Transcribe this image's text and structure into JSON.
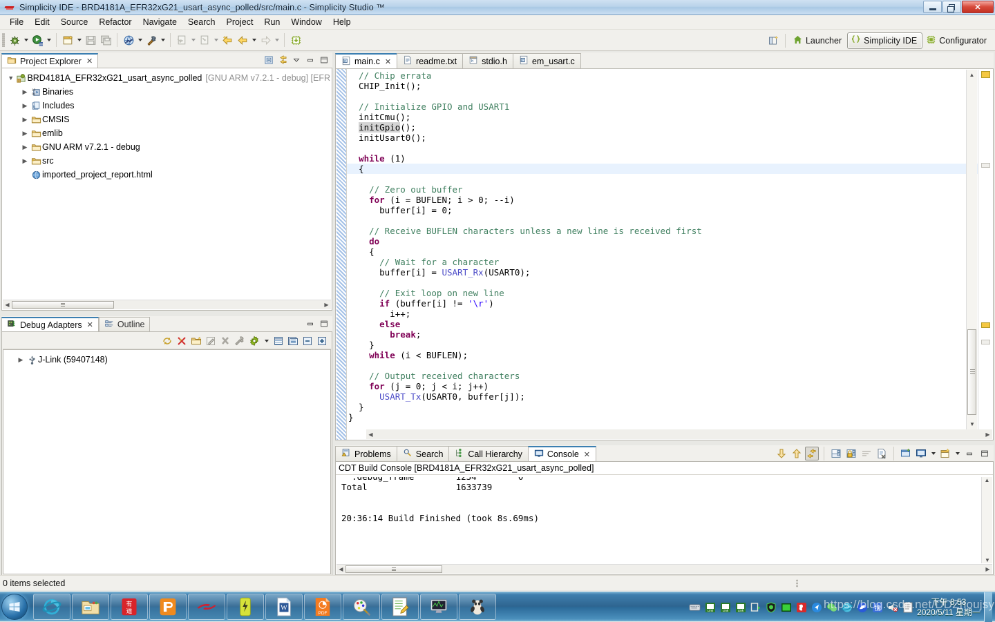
{
  "window": {
    "title": "Simplicity IDE - BRD4181A_EFR32xG21_usart_async_polled/src/main.c - Simplicity Studio ™",
    "app_icon": "simplicity-studio-icon",
    "minimize_label": "Minimize",
    "restore_label": "Restore",
    "close_label": "Close"
  },
  "menubar": {
    "items": [
      "File",
      "Edit",
      "Source",
      "Refactor",
      "Navigate",
      "Search",
      "Project",
      "Run",
      "Window",
      "Help"
    ]
  },
  "toolbar": {
    "buttons": [
      {
        "name": "debug-icon",
        "glyph": "bug"
      },
      {
        "name": "run-icon",
        "glyph": "run"
      },
      {
        "name": "new-icon",
        "glyph": "new"
      },
      {
        "name": "save-icon",
        "glyph": "save"
      },
      {
        "name": "save-all-icon",
        "glyph": "saveall"
      },
      {
        "name": "build-all-icon",
        "glyph": "globe"
      },
      {
        "name": "build-icon",
        "glyph": "hammer"
      },
      {
        "name": "next-annotation-icon",
        "glyph": "nextanno"
      },
      {
        "name": "previous-annotation-icon",
        "glyph": "prevanno"
      },
      {
        "name": "last-edit-location-icon",
        "glyph": "lastedit"
      },
      {
        "name": "back-icon",
        "glyph": "back"
      },
      {
        "name": "forward-icon",
        "glyph": "forward"
      },
      {
        "name": "flash-programmer-icon",
        "glyph": "chip"
      }
    ]
  },
  "perspectives": {
    "open_perspective_label": "Open Perspective",
    "items": [
      {
        "label": "Launcher",
        "icon": "home-icon",
        "active": false
      },
      {
        "label": "Simplicity IDE",
        "icon": "braces-icon",
        "active": true
      },
      {
        "label": "Configurator",
        "icon": "chip-icon",
        "active": false
      }
    ]
  },
  "project_explorer": {
    "tabs": [
      {
        "label": "Project Explorer",
        "active": true,
        "icon": "project-explorer-icon",
        "closable": true
      }
    ],
    "toolbar": [
      {
        "name": "collapse-all-icon"
      },
      {
        "name": "link-with-editor-icon"
      },
      {
        "name": "view-menu-icon"
      },
      {
        "name": "minimize-view-icon"
      },
      {
        "name": "maximize-view-icon"
      }
    ],
    "tree": [
      {
        "indent": 0,
        "twisty": "open",
        "icon": "project-icon",
        "label": "BRD4181A_EFR32xG21_usart_async_polled",
        "suffix": "[GNU ARM v7.2.1 - debug] [EFR"
      },
      {
        "indent": 1,
        "twisty": "closed",
        "icon": "binaries-icon",
        "label": "Binaries",
        "suffix": ""
      },
      {
        "indent": 1,
        "twisty": "closed",
        "icon": "includes-icon",
        "label": "Includes",
        "suffix": ""
      },
      {
        "indent": 1,
        "twisty": "closed",
        "icon": "folder-icon",
        "label": "CMSIS",
        "suffix": ""
      },
      {
        "indent": 1,
        "twisty": "closed",
        "icon": "folder-icon",
        "label": "emlib",
        "suffix": ""
      },
      {
        "indent": 1,
        "twisty": "closed",
        "icon": "folder-icon",
        "label": "GNU ARM v7.2.1 - debug",
        "suffix": ""
      },
      {
        "indent": 1,
        "twisty": "closed",
        "icon": "source-folder-icon",
        "label": "src",
        "suffix": ""
      },
      {
        "indent": 1,
        "twisty": "none",
        "icon": "html-file-icon",
        "label": "imported_project_report.html",
        "suffix": ""
      }
    ]
  },
  "debug_adapters": {
    "tabs": [
      {
        "label": "Debug Adapters",
        "active": true,
        "icon": "debug-adapters-icon",
        "closable": true
      },
      {
        "label": "Outline",
        "active": false,
        "icon": "outline-icon",
        "closable": false
      }
    ],
    "toolbar": [
      {
        "name": "refresh-icon"
      },
      {
        "name": "disconnect-icon"
      },
      {
        "name": "new-folder-icon"
      },
      {
        "name": "rename-icon"
      },
      {
        "name": "delete-icon"
      },
      {
        "name": "device-tools-icon"
      },
      {
        "name": "preferences-gear-icon"
      },
      {
        "name": "dropdown-arrow-icon"
      },
      {
        "name": "list-view-icon"
      },
      {
        "name": "details-view-icon"
      },
      {
        "name": "collapse-all-icon"
      },
      {
        "name": "expand-all-icon"
      }
    ],
    "tree": [
      {
        "indent": 0,
        "twisty": "closed",
        "icon": "usb-icon",
        "label": "J-Link (59407148)"
      }
    ]
  },
  "editor": {
    "tabs": [
      {
        "label": "main.c",
        "icon": "c-file-icon",
        "active": true,
        "closable": true
      },
      {
        "label": "readme.txt",
        "icon": "text-file-icon",
        "active": false,
        "closable": false
      },
      {
        "label": "stdio.h",
        "icon": "h-file-icon",
        "active": false,
        "closable": false
      },
      {
        "label": "em_usart.c",
        "icon": "c-file-icon",
        "active": false,
        "closable": false
      }
    ],
    "code_lines": [
      "  // Chip errata",
      "  CHIP_Init();",
      "",
      "  // Initialize GPIO and USART1",
      "  initCmu();",
      "  initGpio();",
      "  initUsart0();",
      "",
      "  while (1)",
      "  {",
      "",
      "    // Zero out buffer",
      "    for (i = BUFLEN; i > 0; --i)",
      "      buffer[i] = 0;",
      "",
      "    // Receive BUFLEN characters unless a new line is received first",
      "    do",
      "    {",
      "      // Wait for a character",
      "      buffer[i] = USART_Rx(USART0);",
      "",
      "      // Exit loop on new line",
      "      if (buffer[i] != '\\r')",
      "        i++;",
      "      else",
      "        break;",
      "    }",
      "    while (i < BUFLEN);",
      "",
      "    // Output received characters",
      "    for (j = 0; j < i; j++)",
      "      USART_Tx(USART0, buffer[j]);",
      "  }",
      "}"
    ],
    "highlighted_token": "initGpio",
    "highlighted_line_index": 9
  },
  "console": {
    "tabs": [
      {
        "label": "Problems",
        "icon": "problems-icon",
        "active": false,
        "closable": false
      },
      {
        "label": "Search",
        "icon": "search-icon",
        "active": false,
        "closable": false
      },
      {
        "label": "Call Hierarchy",
        "icon": "call-hierarchy-icon",
        "active": false,
        "closable": false
      },
      {
        "label": "Console",
        "icon": "console-icon",
        "active": true,
        "closable": true
      }
    ],
    "toolbar": [
      {
        "name": "scroll-down-icon"
      },
      {
        "name": "scroll-up-icon"
      },
      {
        "name": "scroll-lock-icon",
        "pressed": true
      },
      {
        "name": "clear-console-icon"
      },
      {
        "name": "pin-console-icon"
      },
      {
        "name": "word-wrap-icon"
      },
      {
        "name": "remove-console-icon"
      },
      {
        "name": "open-console-icon"
      },
      {
        "name": "display-selected-console-icon"
      },
      {
        "name": "console-dropdown-icon"
      },
      {
        "name": "new-console-view-icon"
      },
      {
        "name": "new-console-dropdown-icon"
      },
      {
        "name": "minimize-view-icon"
      },
      {
        "name": "maximize-view-icon"
      }
    ],
    "title": "CDT Build Console [BRD4181A_EFR32xG21_usart_async_polled]",
    "lines": [
      {
        "text": "Total                 1633739",
        "color": "black"
      },
      {
        "text": "",
        "color": "black"
      },
      {
        "text": "",
        "color": "black"
      },
      {
        "text": "",
        "color": "black"
      },
      {
        "text": "",
        "color": "black"
      },
      {
        "text": "20:36:14 Build Finished (took 8s.69ms)",
        "color": "blue"
      }
    ]
  },
  "statusbar": {
    "text": "0 items selected"
  },
  "taskbar": {
    "start_label": "Start",
    "quick_launch": [
      {
        "name": "internet-explorer-icon"
      },
      {
        "name": "file-explorer-icon"
      },
      {
        "name": "youdao-dictionary-icon"
      },
      {
        "name": "app-orange-icon"
      },
      {
        "name": "simplicity-studio-icon"
      },
      {
        "name": "energy-profiler-icon"
      },
      {
        "name": "word-icon"
      },
      {
        "name": "pdf-icon"
      },
      {
        "name": "paint-icon"
      },
      {
        "name": "notepad-plus-icon"
      },
      {
        "name": "monitor-icon"
      },
      {
        "name": "kungfu-panda-icon"
      }
    ],
    "tray": [
      {
        "name": "keyboard-icon"
      },
      {
        "name": "jlink-icon"
      },
      {
        "name": "jlink-icon"
      },
      {
        "name": "jlink-icon"
      },
      {
        "name": "clone-icon"
      },
      {
        "name": "shield-icon"
      },
      {
        "name": "terminal-icon"
      },
      {
        "name": "qq-icon"
      },
      {
        "name": "blue-arrow-icon"
      },
      {
        "name": "wechat-icon"
      },
      {
        "name": "ie-icon"
      },
      {
        "name": "browser-icon"
      },
      {
        "name": "ime-icon"
      },
      {
        "name": "volume-mute-icon"
      },
      {
        "name": "action-center-icon"
      }
    ],
    "clock_time": "下午 8:53",
    "clock_date": "2020/5/11 星期一"
  },
  "watermark": {
    "text": "https://blog.csdn.net/DDZhoujsy"
  },
  "colors": {
    "accent": "#3c7fb1",
    "comment": "#3f7f5f",
    "keyword": "#7f0055",
    "function": "#4a4ac7",
    "string": "#2a00ff",
    "console_blue": "#1414c8",
    "taskbar": "#2e6590"
  }
}
